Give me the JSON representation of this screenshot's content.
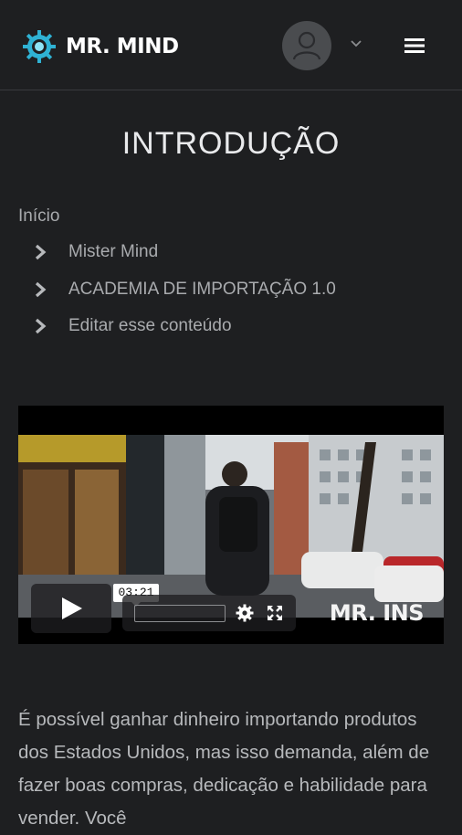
{
  "header": {
    "brand": "MR. MIND",
    "icons": {
      "logo": "gear-logo-icon",
      "avatar": "user-avatar-icon",
      "dropdown": "chevron-down-icon",
      "menu": "hamburger-menu-icon"
    }
  },
  "page": {
    "title": "INTRODUÇÃO"
  },
  "breadcrumb": {
    "home": "Início",
    "items": [
      {
        "label": "Mister Mind"
      },
      {
        "label": "ACADEMIA DE IMPORTAÇÃO 1.0"
      },
      {
        "label": "Editar esse conteúdo"
      }
    ]
  },
  "video": {
    "watermark": "MR. INS",
    "timecode": "03:21",
    "progress": 0.0,
    "icons": {
      "play": "play-icon",
      "settings": "gear-icon",
      "fullscreen": "fullscreen-icon"
    }
  },
  "content": {
    "text": "É possível ganhar dinheiro importando produtos dos Estados Unidos, mas isso demanda, além de fazer boas compras, dedicação e habilidade para vender. Você"
  },
  "colors": {
    "background": "#1e1f21",
    "accent": "#3bb6d6",
    "text": "#b7b9bc"
  }
}
